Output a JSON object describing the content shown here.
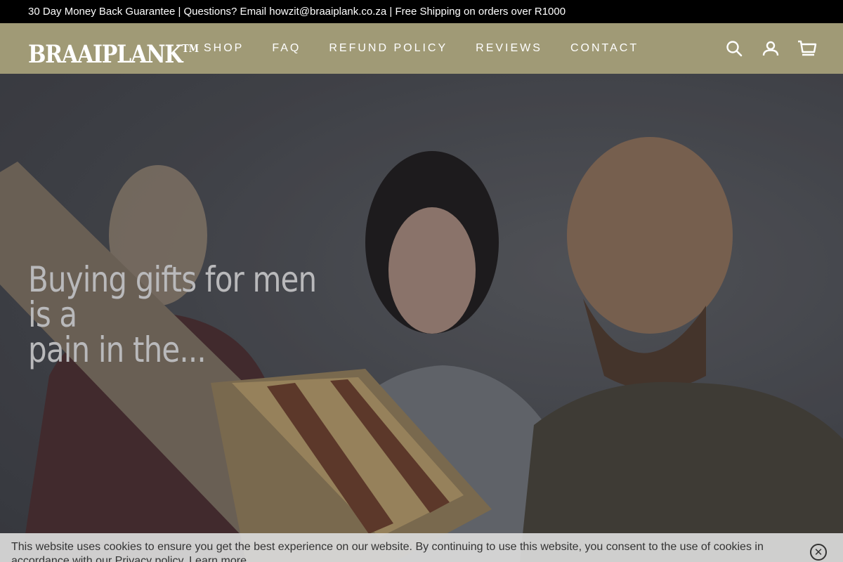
{
  "announcement": {
    "text": "30 Day Money Back Guarantee | Questions? Email howzit@braaiplank.co.za | Free Shipping on orders over R1000"
  },
  "header": {
    "logo_text": "BRAAIPLANK",
    "logo_tm": "TM",
    "nav": [
      {
        "label": "SHOP"
      },
      {
        "label": "FAQ"
      },
      {
        "label": "REFUND POLICY"
      },
      {
        "label": "REVIEWS"
      },
      {
        "label": "CONTACT"
      }
    ],
    "icons": [
      "search-icon",
      "account-icon",
      "cart-icon"
    ]
  },
  "hero": {
    "title_line1": "Buying gifts for men is a",
    "title_line2": "pain in the..."
  },
  "cookie": {
    "text": "This website uses cookies to ensure you get the best experience on our website. By continuing to use this website, you consent to the use of cookies in accordance with our ",
    "privacy_link": "Privacy policy",
    "learn_more": "Learn more",
    "close_glyph": "✕"
  },
  "colors": {
    "announcement_bg": "#000000",
    "header_bg": "#a09a76",
    "hero_bg": "#4a4c52",
    "cookie_bg": "#dadada"
  }
}
